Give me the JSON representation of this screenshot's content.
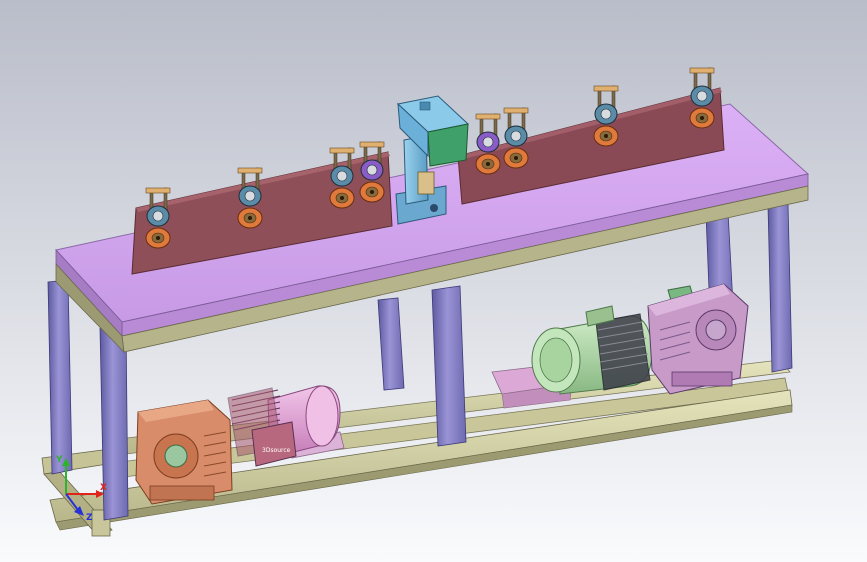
{
  "window": {
    "title": ""
  },
  "viewport": {
    "background_top": "#b9bdc9",
    "background_bottom": "#fafbfd"
  },
  "colors": {
    "top_plate": "#d6a6f2",
    "top_plate_edge": "#b98ad6",
    "frame_tube": "#8c86c9",
    "frame_tube_dark": "#5e5aa0",
    "base_rail": "#d8d6a8",
    "backing_panel_left": "#8e4f58",
    "backing_panel_right": "#8a4a55",
    "gearbox_left": "#d98c6a",
    "motor_left": "#e6a8d8",
    "gearbox_right": "#c89ac8",
    "motor_right": "#b6dcb0",
    "press_head": "#7cbde0",
    "press_body": "#3fa06a",
    "roller_gear": "#e07a3c",
    "roller_top": "#5a8ca8",
    "roller_purple": "#8a5cc8"
  },
  "model": {
    "motor_brand_label": "3Dsource"
  },
  "coordinate_triad": {
    "x_label": "X",
    "y_label": "Y",
    "z_label": "Z",
    "x_color": "#e0241c",
    "y_color": "#2bb52b",
    "z_color": "#2632d8"
  },
  "icons": {
    "triad": "coordinate-triad-icon"
  }
}
